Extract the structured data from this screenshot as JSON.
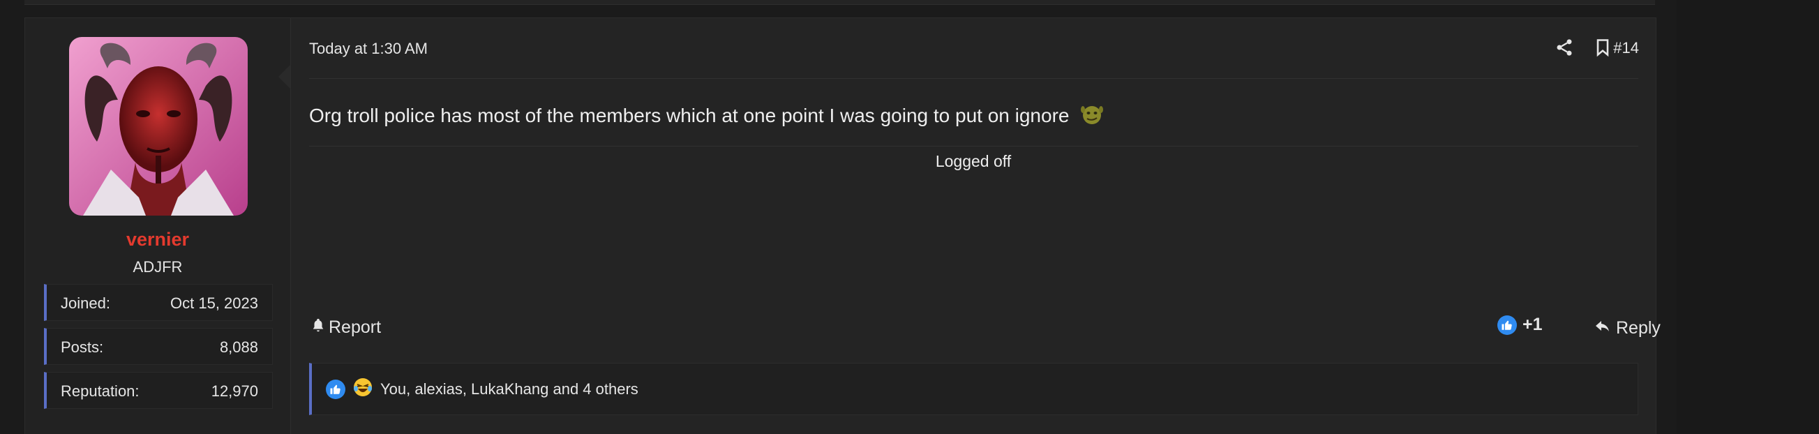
{
  "post": {
    "user": {
      "name": "vernier",
      "title": "ADJFR",
      "stats": [
        {
          "label": "Joined:",
          "value": "Oct 15, 2023"
        },
        {
          "label": "Posts:",
          "value": "8,088"
        },
        {
          "label": "Reputation:",
          "value": "12,970"
        }
      ]
    },
    "time": "Today at 1:30 AM",
    "number": "#14",
    "body": "Org troll police has most of the members which at one point I was going to put on ignore",
    "emoji": "shrek-emoji",
    "signature": "Logged off",
    "actions": {
      "report_label": "Report",
      "reaction_count": "+1",
      "reply_label": "Reply"
    },
    "reactions_summary": "You, alexias, LukaKhang and 4 others"
  },
  "colors": {
    "username": "#e43a2e",
    "accent": "#5a6ec6",
    "like": "#2f8bf0"
  }
}
